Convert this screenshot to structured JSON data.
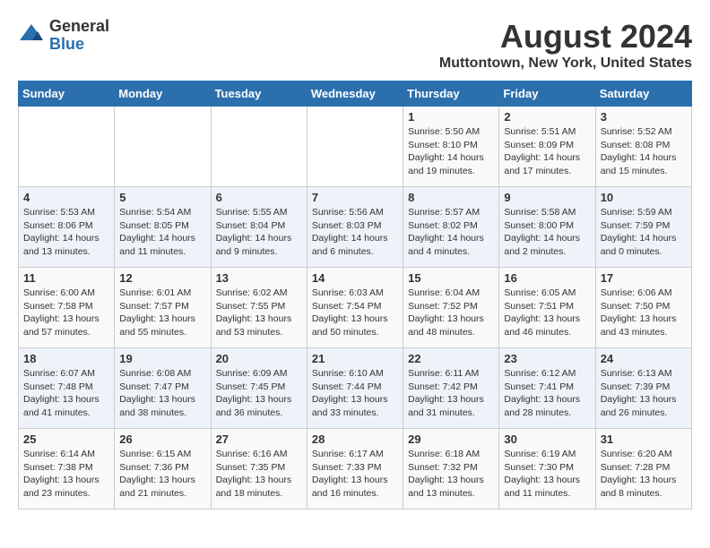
{
  "logo": {
    "general": "General",
    "blue": "Blue"
  },
  "title": "August 2024",
  "location": "Muttontown, New York, United States",
  "days_header": [
    "Sunday",
    "Monday",
    "Tuesday",
    "Wednesday",
    "Thursday",
    "Friday",
    "Saturday"
  ],
  "weeks": [
    [
      {
        "day": "",
        "info": ""
      },
      {
        "day": "",
        "info": ""
      },
      {
        "day": "",
        "info": ""
      },
      {
        "day": "",
        "info": ""
      },
      {
        "day": "1",
        "info": "Sunrise: 5:50 AM\nSunset: 8:10 PM\nDaylight: 14 hours\nand 19 minutes."
      },
      {
        "day": "2",
        "info": "Sunrise: 5:51 AM\nSunset: 8:09 PM\nDaylight: 14 hours\nand 17 minutes."
      },
      {
        "day": "3",
        "info": "Sunrise: 5:52 AM\nSunset: 8:08 PM\nDaylight: 14 hours\nand 15 minutes."
      }
    ],
    [
      {
        "day": "4",
        "info": "Sunrise: 5:53 AM\nSunset: 8:06 PM\nDaylight: 14 hours\nand 13 minutes."
      },
      {
        "day": "5",
        "info": "Sunrise: 5:54 AM\nSunset: 8:05 PM\nDaylight: 14 hours\nand 11 minutes."
      },
      {
        "day": "6",
        "info": "Sunrise: 5:55 AM\nSunset: 8:04 PM\nDaylight: 14 hours\nand 9 minutes."
      },
      {
        "day": "7",
        "info": "Sunrise: 5:56 AM\nSunset: 8:03 PM\nDaylight: 14 hours\nand 6 minutes."
      },
      {
        "day": "8",
        "info": "Sunrise: 5:57 AM\nSunset: 8:02 PM\nDaylight: 14 hours\nand 4 minutes."
      },
      {
        "day": "9",
        "info": "Sunrise: 5:58 AM\nSunset: 8:00 PM\nDaylight: 14 hours\nand 2 minutes."
      },
      {
        "day": "10",
        "info": "Sunrise: 5:59 AM\nSunset: 7:59 PM\nDaylight: 14 hours\nand 0 minutes."
      }
    ],
    [
      {
        "day": "11",
        "info": "Sunrise: 6:00 AM\nSunset: 7:58 PM\nDaylight: 13 hours\nand 57 minutes."
      },
      {
        "day": "12",
        "info": "Sunrise: 6:01 AM\nSunset: 7:57 PM\nDaylight: 13 hours\nand 55 minutes."
      },
      {
        "day": "13",
        "info": "Sunrise: 6:02 AM\nSunset: 7:55 PM\nDaylight: 13 hours\nand 53 minutes."
      },
      {
        "day": "14",
        "info": "Sunrise: 6:03 AM\nSunset: 7:54 PM\nDaylight: 13 hours\nand 50 minutes."
      },
      {
        "day": "15",
        "info": "Sunrise: 6:04 AM\nSunset: 7:52 PM\nDaylight: 13 hours\nand 48 minutes."
      },
      {
        "day": "16",
        "info": "Sunrise: 6:05 AM\nSunset: 7:51 PM\nDaylight: 13 hours\nand 46 minutes."
      },
      {
        "day": "17",
        "info": "Sunrise: 6:06 AM\nSunset: 7:50 PM\nDaylight: 13 hours\nand 43 minutes."
      }
    ],
    [
      {
        "day": "18",
        "info": "Sunrise: 6:07 AM\nSunset: 7:48 PM\nDaylight: 13 hours\nand 41 minutes."
      },
      {
        "day": "19",
        "info": "Sunrise: 6:08 AM\nSunset: 7:47 PM\nDaylight: 13 hours\nand 38 minutes."
      },
      {
        "day": "20",
        "info": "Sunrise: 6:09 AM\nSunset: 7:45 PM\nDaylight: 13 hours\nand 36 minutes."
      },
      {
        "day": "21",
        "info": "Sunrise: 6:10 AM\nSunset: 7:44 PM\nDaylight: 13 hours\nand 33 minutes."
      },
      {
        "day": "22",
        "info": "Sunrise: 6:11 AM\nSunset: 7:42 PM\nDaylight: 13 hours\nand 31 minutes."
      },
      {
        "day": "23",
        "info": "Sunrise: 6:12 AM\nSunset: 7:41 PM\nDaylight: 13 hours\nand 28 minutes."
      },
      {
        "day": "24",
        "info": "Sunrise: 6:13 AM\nSunset: 7:39 PM\nDaylight: 13 hours\nand 26 minutes."
      }
    ],
    [
      {
        "day": "25",
        "info": "Sunrise: 6:14 AM\nSunset: 7:38 PM\nDaylight: 13 hours\nand 23 minutes."
      },
      {
        "day": "26",
        "info": "Sunrise: 6:15 AM\nSunset: 7:36 PM\nDaylight: 13 hours\nand 21 minutes."
      },
      {
        "day": "27",
        "info": "Sunrise: 6:16 AM\nSunset: 7:35 PM\nDaylight: 13 hours\nand 18 minutes."
      },
      {
        "day": "28",
        "info": "Sunrise: 6:17 AM\nSunset: 7:33 PM\nDaylight: 13 hours\nand 16 minutes."
      },
      {
        "day": "29",
        "info": "Sunrise: 6:18 AM\nSunset: 7:32 PM\nDaylight: 13 hours\nand 13 minutes."
      },
      {
        "day": "30",
        "info": "Sunrise: 6:19 AM\nSunset: 7:30 PM\nDaylight: 13 hours\nand 11 minutes."
      },
      {
        "day": "31",
        "info": "Sunrise: 6:20 AM\nSunset: 7:28 PM\nDaylight: 13 hours\nand 8 minutes."
      }
    ]
  ]
}
